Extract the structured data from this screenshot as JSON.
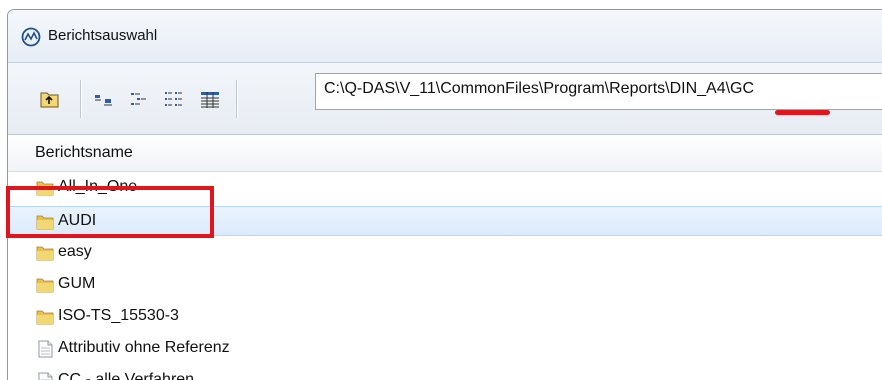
{
  "window": {
    "title": "Berichtsauswahl",
    "app_icon": "qdas-logo-icon"
  },
  "toolbar": {
    "buttons": [
      {
        "name": "folder-up-icon"
      },
      {
        "name": "large-icons-view-icon"
      },
      {
        "name": "small-icons-view-icon"
      },
      {
        "name": "list-view-icon"
      },
      {
        "name": "details-view-icon"
      }
    ],
    "path": "C:\\Q-DAS\\V_11\\CommonFiles\\Program\\Reports\\DIN_A4\\GC"
  },
  "list": {
    "column_header": "Berichtsname",
    "items": [
      {
        "label": "All_In_One",
        "type": "folder"
      },
      {
        "label": "AUDI",
        "type": "folder",
        "selected": true
      },
      {
        "label": "easy",
        "type": "folder"
      },
      {
        "label": "GUM",
        "type": "folder"
      },
      {
        "label": "ISO-TS_15530-3",
        "type": "folder"
      },
      {
        "label": "Attributiv ohne Referenz",
        "type": "file"
      },
      {
        "label": "CC - alle Verfahren",
        "type": "file"
      }
    ]
  },
  "colors": {
    "annotation_red": "#e0161f",
    "selection_blue": "#dcebfc",
    "folder_yellow": "#e8c14a"
  }
}
